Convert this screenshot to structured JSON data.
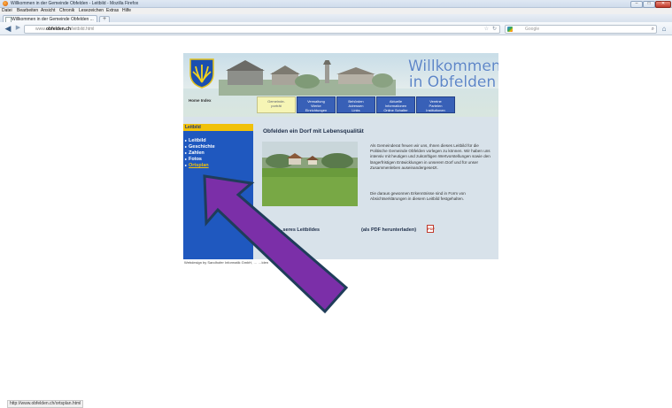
{
  "browser": {
    "window_title": "Willkommen in der Gemeinde Obfelden - Leitbild - Mozilla Firefox",
    "window_buttons": [
      "–",
      "□",
      "✕"
    ],
    "menu": [
      "Datei",
      "Bearbeiten",
      "Ansicht",
      "Chronik",
      "Lesezeichen",
      "Extras",
      "Hilfe"
    ],
    "tab_label": "Willkommen in der Gemeinde Obfelden ...",
    "newtab_label": "+",
    "url_prefix": "www.",
    "url_domain": "obfelden.ch",
    "url_path": "/leitbild.html",
    "search_placeholder": "Google",
    "status_url": "http://www.obfelden.ch/ortsplan.html"
  },
  "site": {
    "welcome_line1": "Willkommen",
    "welcome_line2": "in Obfelden",
    "home_index": "Home  Index",
    "nav": [
      {
        "line1": "Gemeinde-",
        "line2": "porträt",
        "line3": ""
      },
      {
        "line1": "Verwaltung",
        "line2": "Werke",
        "line3": "Einrichtungen"
      },
      {
        "line1": "Behörden",
        "line2": "Adressen",
        "line3": "Links"
      },
      {
        "line1": "Aktuelle",
        "line2": "Informationen",
        "line3": "Online Schalter"
      },
      {
        "line1": "Vereine",
        "line2": "Parteien",
        "line3": "Institutionen"
      }
    ],
    "sidebar": {
      "heading": "Leitbild",
      "items": [
        "Leitbild",
        "Geschichte",
        "Zahlen",
        "Fotos",
        "Ortsplan"
      ]
    },
    "content": {
      "title": "Obfelden ein Dorf mit Lebensqualität",
      "para1": "Als Gemeinderat freuen wir uns, Ihnen dieses Leitbild für die Politische Gemeinde Obfelden vorlegen zu können. Wir haben uns intensiv mit heutigen und zukünftigen Wertvorstellungen sowie den längerfristigen Entwicklungen in unserem Dorf und für unser Zusammenleben auseinandergesetzt.",
      "para2": "Die daraus gewonnen Erkenntnisse sind in Form von Absichtserklärungen in diesem Leitbild festgehalten.",
      "leitbild_label": "…seres Leitbildes",
      "pdf_label": "(als PDF herunterladen)",
      "pdf_icon_text": "PDF"
    },
    "footer": "Webdesign by Sandhofer Informatik GmbH, …                       …lden"
  },
  "colors": {
    "nav_blue": "#3860b7",
    "sidebar_blue": "#1f58bf",
    "sidebar_heading_yellow": "#f1c10a",
    "arrow_purple": "#7b2fa8",
    "arrow_outline": "#1f3d5a"
  }
}
